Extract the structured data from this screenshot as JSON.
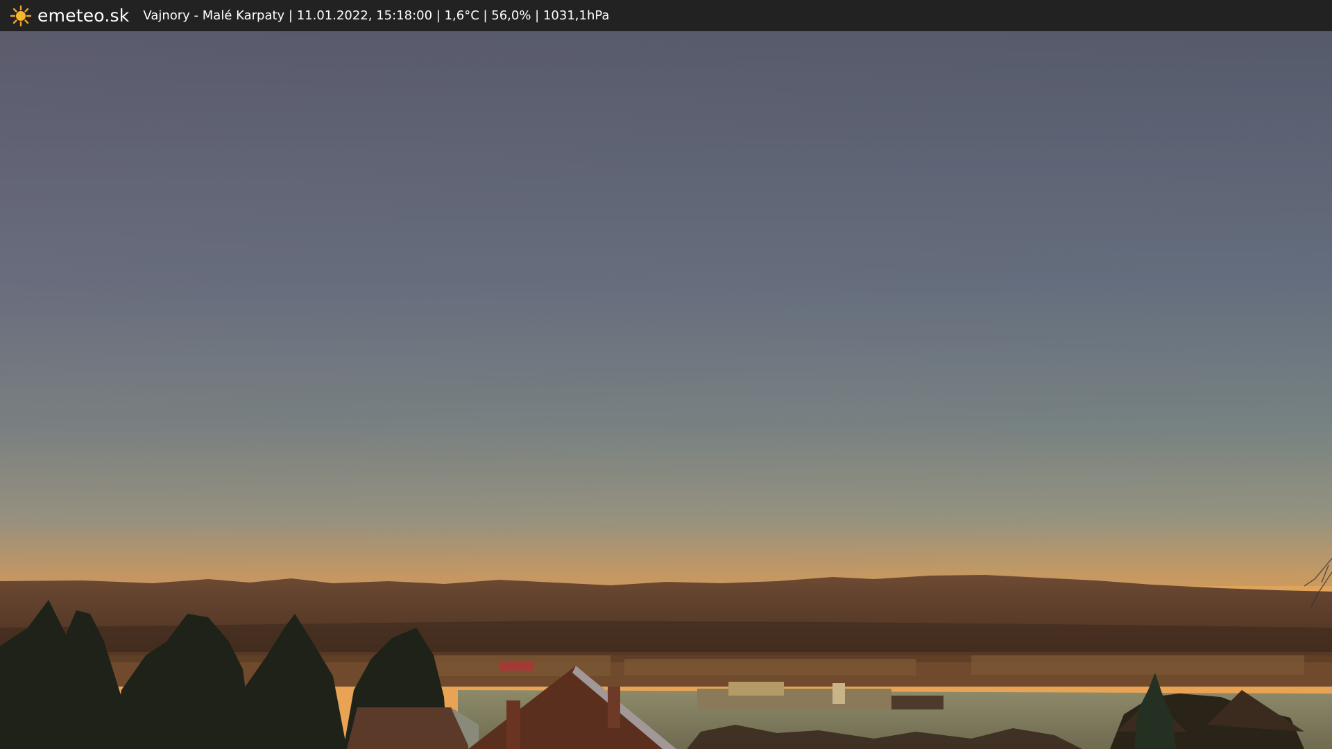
{
  "header": {
    "brand": "emeteo.sk",
    "logo_icon": "sun-icon",
    "caption": "Vajnory - Malé Karpaty | 11.01.2022, 15:18:00 | 1,6°C | 56,0% | 1031,1hPa"
  },
  "colors": {
    "bar_bg": "#222222",
    "sun": "#f5a623",
    "sky_top": "#5c6273",
    "sky_horizon": "#e8a85a"
  }
}
